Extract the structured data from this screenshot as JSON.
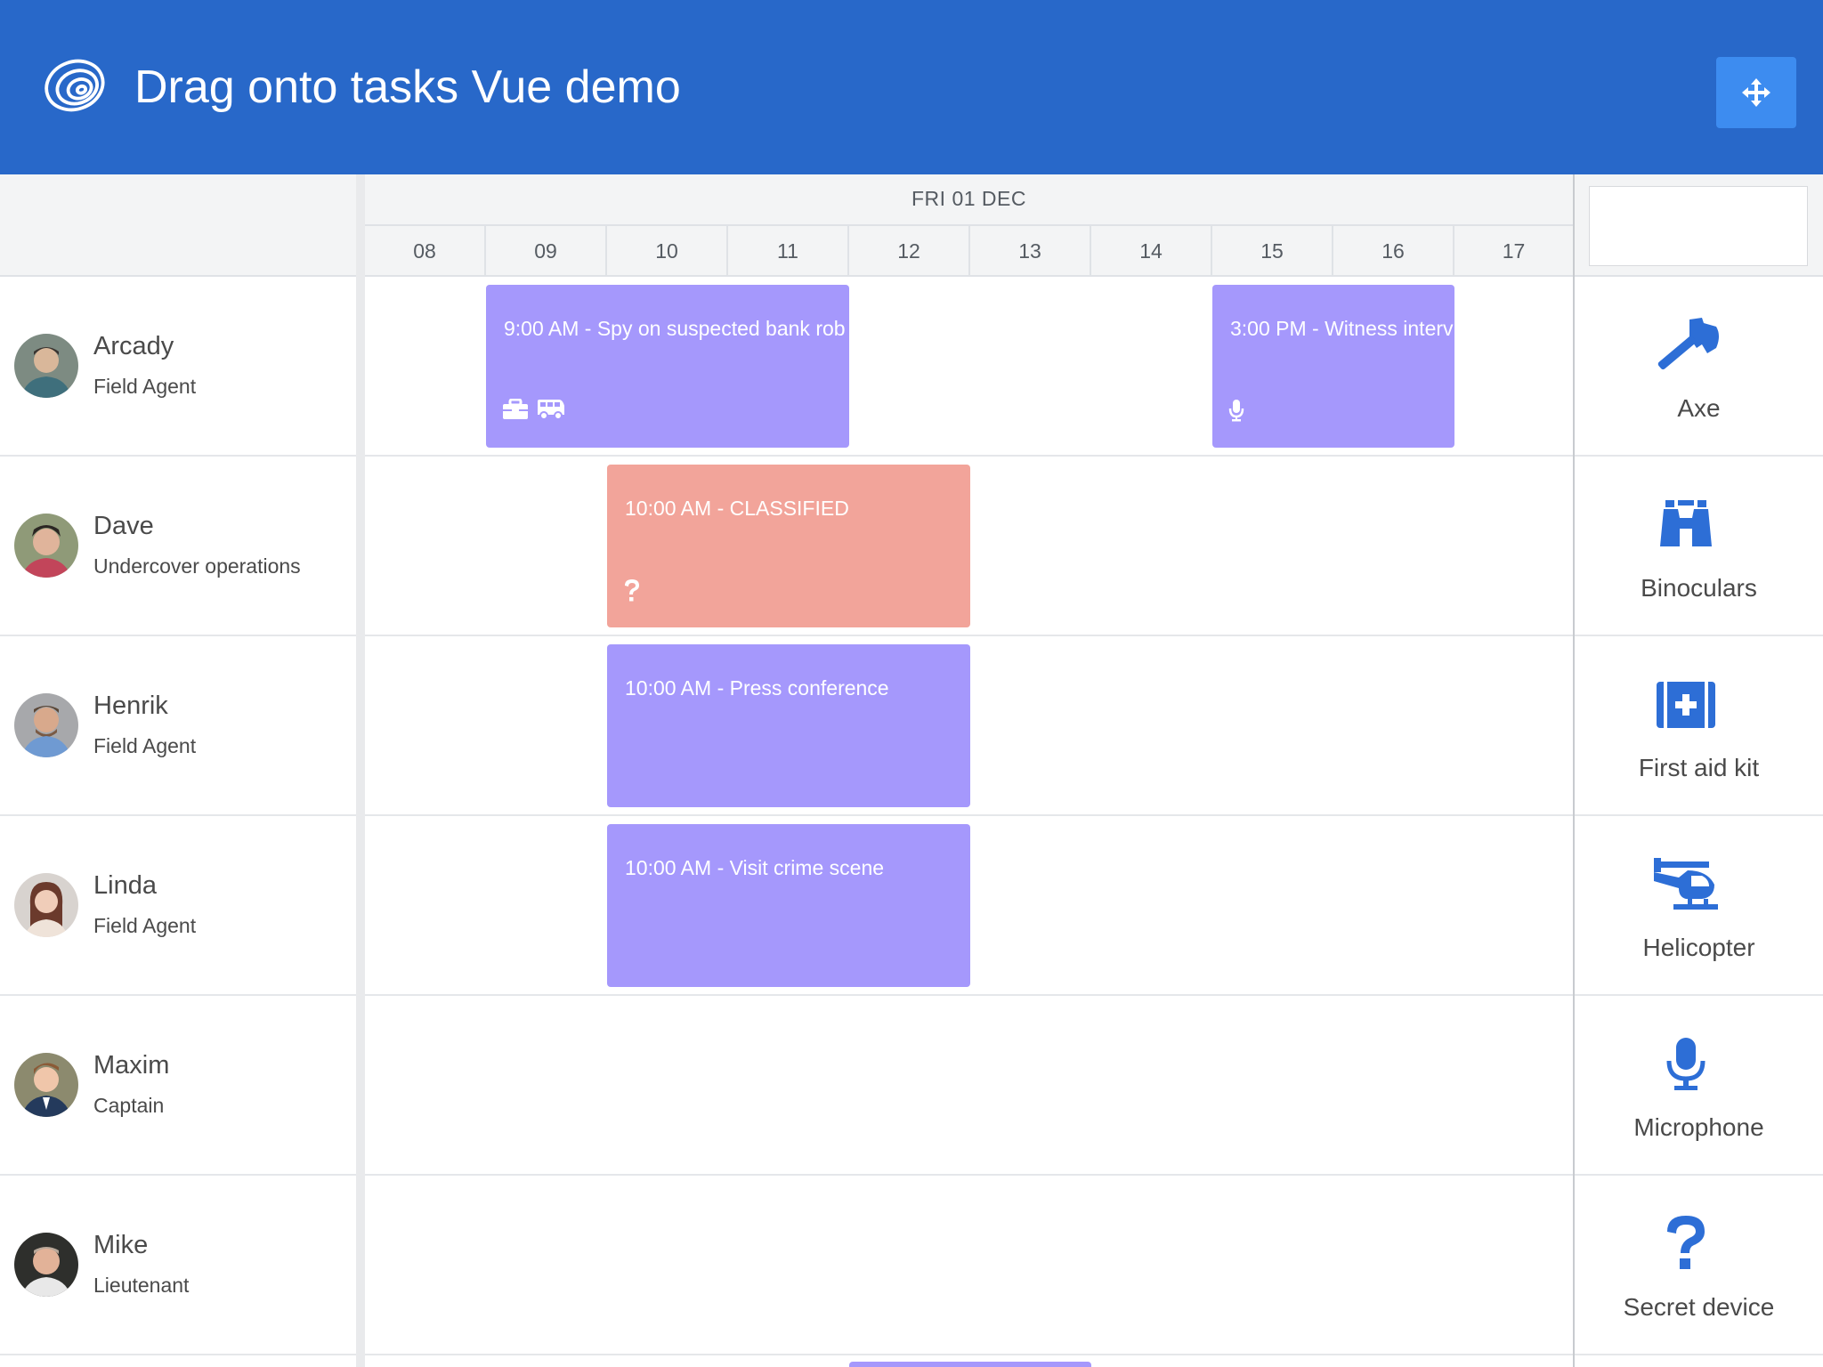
{
  "header": {
    "title": "Drag onto tasks Vue demo",
    "logo_icon": "bryntum-spiral-logo",
    "move_button_icon": "arrows-move-icon"
  },
  "colors": {
    "header_bg": "#2868c9",
    "button_bg": "#3d8cf0",
    "event_purple": "#a598fc",
    "event_red": "#f2a49a",
    "equipment_icon": "#2d6ed6"
  },
  "timeline": {
    "date_label": "FRI 01 DEC",
    "hours": [
      "08",
      "09",
      "10",
      "11",
      "12",
      "13",
      "14",
      "15",
      "16",
      "17"
    ]
  },
  "resources": [
    {
      "name": "Arcady",
      "role": "Field Agent"
    },
    {
      "name": "Dave",
      "role": "Undercover operations"
    },
    {
      "name": "Henrik",
      "role": "Field Agent"
    },
    {
      "name": "Linda",
      "role": "Field Agent"
    },
    {
      "name": "Maxim",
      "role": "Captain"
    },
    {
      "name": "Mike",
      "role": "Lieutenant"
    }
  ],
  "events": [
    {
      "label": "9:00 AM - Spy on suspected bank rob",
      "icons": [
        "toolbox-icon",
        "van-icon"
      ]
    },
    {
      "label": "3:00 PM - Witness interv",
      "icons": [
        "microphone-icon"
      ]
    },
    {
      "label": "10:00 AM - CLASSIFIED",
      "icons": [
        "question-icon"
      ]
    },
    {
      "label": "10:00 AM - Press conference",
      "icons": []
    },
    {
      "label": "10:00 AM - Visit crime scene",
      "icons": []
    }
  ],
  "equipment": {
    "filter_value": "",
    "items": [
      {
        "label": "Axe",
        "icon": "axe-icon"
      },
      {
        "label": "Binoculars",
        "icon": "binoculars-icon"
      },
      {
        "label": "First aid kit",
        "icon": "first-aid-kit-icon"
      },
      {
        "label": "Helicopter",
        "icon": "helicopter-icon"
      },
      {
        "label": "Microphone",
        "icon": "microphone-icon"
      },
      {
        "label": "Secret device",
        "icon": "question-icon"
      }
    ]
  }
}
